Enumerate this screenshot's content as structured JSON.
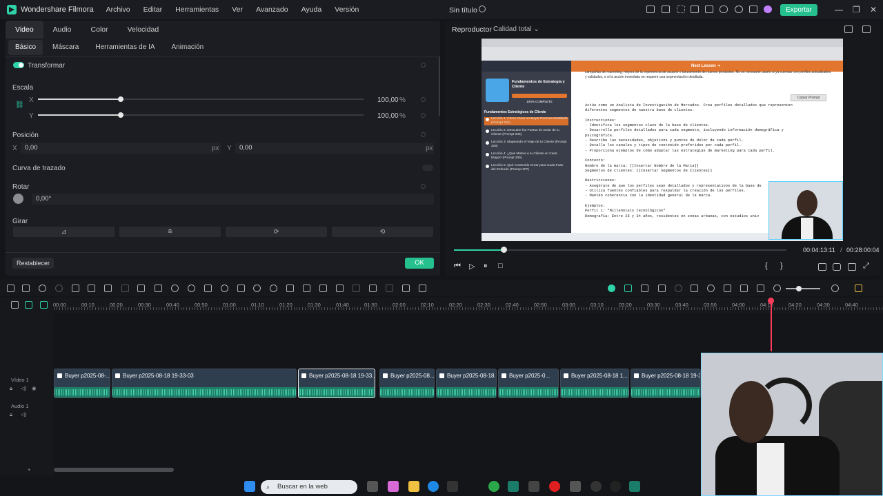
{
  "app": {
    "name": "Wondershare Filmora",
    "menu": [
      "Archivo",
      "Editar",
      "Herramientas",
      "Ver",
      "Avanzado",
      "Ayuda",
      "Versión"
    ],
    "document_title": "Sin título",
    "export_label": "Exportar"
  },
  "left_panel": {
    "tabs": [
      "Video",
      "Audio",
      "Color",
      "Velocidad"
    ],
    "subtabs": [
      "Básico",
      "Máscara",
      "Herramientas de IA",
      "Animación"
    ],
    "transform_label": "Transformar",
    "scale": {
      "label": "Escala",
      "x_label": "X",
      "y_label": "Y",
      "x_value": "100,00",
      "y_value": "100,00",
      "unit": "%",
      "x_fraction": 1.0,
      "y_fraction": 1.0
    },
    "position": {
      "label": "Posición",
      "x_label": "X",
      "x_value": "0,00",
      "y_label": "Y",
      "y_value": "0,00",
      "unit": "px"
    },
    "path_curve_label": "Curva de trazado",
    "rotate": {
      "label": "Rotar",
      "value": "0,00°"
    },
    "flip_label": "Girar",
    "reset_label": "Restablecer",
    "ok_label": "OK"
  },
  "player": {
    "title": "Reproductor",
    "quality": "Calidad total",
    "current_time": "00:04:13:11",
    "total_time": "00:28:00:04",
    "progress_fraction": 0.15
  },
  "preview": {
    "next_lesson": "Next Lesson ➔",
    "course_title": "Fundamentos de Estrategia y Cliente",
    "complete": "100% COMPLETE",
    "section_title": "Fundamentos Estratégicos de Cliente",
    "lessons": [
      "Lección 1: Cómo Crear un Buyer Persona Detallado (Prompt 204)",
      "Lección 2: Descubre los Puntos de Dolor de tu Cliente (Prompt 205)",
      "Lección 3: Mapeando el Viaje de tu Cliente (Prompt 205)",
      "Lección 4: ¿Qué Motiva a tu Cliente en Cada Etapa? (Prompt 206)",
      "Lección 5: Qué Contenido Crear para Cada Fase del Embudo (Prompt 207)"
    ],
    "intro": "campañas de marketing, mejora de la experiencia de usuario o lanzamiento de nuevos productos. No es necesario usarlo si ya cuentas con perfiles actualizados y validados, o si la acción inmediata no requiere una segmentación detallada.",
    "copy_prompt": "Copiar Prompt",
    "prompt_lines": [
      "Actúa como un Analista de Investigación de Mercados. Crea perfiles detallados que representen",
      "diferentes segmentos de nuestra base de clientes.",
      "",
      "Instrucciones:",
      "- Identifica los segmentos clave de la base de clientes.",
      "- Desarrolla perfiles detallados para cada segmento, incluyendo información demográfica y",
      "psicográfica.",
      "- Describe las necesidades, objetivos y puntos de dolor de cada perfil.",
      "- Detalla los canales y tipos de contenido preferidos por cada perfil.",
      "- Proporciona ejemplos de cómo adaptar las estrategias de marketing para cada perfil.",
      "",
      "Contexto:",
      "Nombre de la marca: [[Insertar Nombre de la Marca]]",
      "Segmentos de clientes: [[Insertar Segmentos de Clientes]]",
      "",
      "Restricciones:",
      "- Asegúrate de que los perfiles sean detallados y representativos de la base de",
      "- Utiliza fuentes confiables para respaldar la creación de los perfiles.",
      "- Mantén coherencia con la identidad general de la marca.",
      "",
      "Ejemplos:",
      "Perfil 1: \"Millennials tecnológicos\"",
      "Demografía: Entre 25 y 34 años, residentes en zonas urbanas, con estudios univ"
    ]
  },
  "timeline": {
    "ticks": [
      "00:00",
      "00:10",
      "00:20",
      "00:30",
      "00:40",
      "00:50",
      "01:00",
      "01:10",
      "01:20",
      "01:30",
      "01:40",
      "01:50",
      "02:00",
      "02:10",
      "02:20",
      "02:30",
      "02:40",
      "02:50",
      "03:00",
      "03:10",
      "03:20",
      "03:30",
      "03:40",
      "03:50",
      "04:00",
      "04:10",
      "04:20",
      "04:30",
      "04:40"
    ],
    "video_track_label": "Vídeo 1",
    "audio_track_label": "Audio 1",
    "clips": [
      "Buyer p2025-08-...",
      "Buyer p2025-08-18 19-33-03",
      "Buyer p2025-08-18 19-33...",
      "Buyer p2025-08...",
      "Buyer p2025-08-18...",
      "Buyer p2025-0...",
      "Buyer p2025-08-18 1...",
      "Buyer p2025-08-18 19-33"
    ]
  },
  "taskbar": {
    "search_placeholder": "Buscar en la web"
  },
  "colors": {
    "accent": "#25c08e",
    "playhead": "#ff3b5c",
    "panel": "#1c1d22"
  }
}
